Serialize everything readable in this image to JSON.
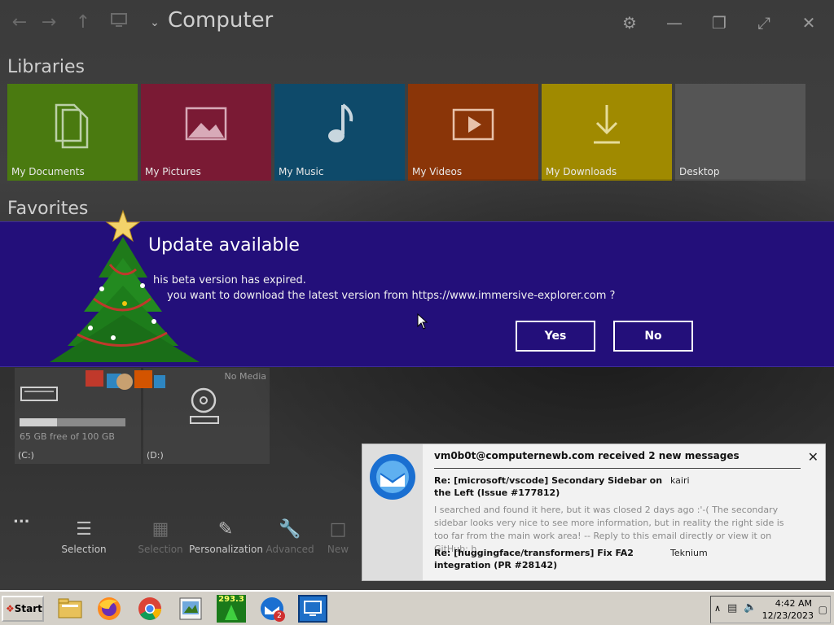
{
  "app": {
    "title": "Computer",
    "libraries_title": "Libraries",
    "favorites_title": "Favorites",
    "libraries": [
      {
        "label": "My Documents",
        "color": "#4a7a10",
        "icon": "documents-icon"
      },
      {
        "label": "My Pictures",
        "color": "#7a1a34",
        "icon": "pictures-icon"
      },
      {
        "label": "My Music",
        "color": "#0e4a6a",
        "icon": "music-icon"
      },
      {
        "label": "My Videos",
        "color": "#8a3508",
        "icon": "videos-icon"
      },
      {
        "label": "My Downloads",
        "color": "#a08a00",
        "icon": "downloads-icon"
      },
      {
        "label": "Desktop",
        "color": "#555555",
        "icon": "desktop-icon"
      }
    ],
    "drives": [
      {
        "label": "(C:)",
        "free": "65 GB free of 100 GB",
        "used_fraction": 0.35
      },
      {
        "label": "(D:)",
        "media": "No Media"
      }
    ],
    "more_label": "...",
    "commands": [
      {
        "label": "Selection",
        "enabled": true
      },
      {
        "label": "Selection",
        "enabled": false
      },
      {
        "label": "Personalization",
        "enabled": true
      },
      {
        "label": "Advanced",
        "enabled": false
      },
      {
        "label": "New",
        "enabled": false
      }
    ]
  },
  "dialog": {
    "title": "Update available",
    "line1": "his beta version has expired.",
    "line2": "you want to download the latest version from https://www.immersive-explorer.com ?",
    "yes": "Yes",
    "no": "No"
  },
  "tree_widget": {
    "icon": "christmas-tree-icon",
    "counter": "293.3"
  },
  "notification": {
    "header": "vm0b0t@computernewb.com received 2 new messages",
    "messages": [
      {
        "subject": "Re: [microsoft/vscode] Secondary Sidebar on the Left (Issue #177812)",
        "from": "kairi",
        "preview": "I searched and found it here, but it was closed 2 days ago :'-( The secondary sidebar looks very nice to see more information, but in reality the right side is too far from the main work area! -- Reply to this email directly or view it on GitHub: h"
      },
      {
        "subject": "Re: [huggingface/transformers] Fix FA2 integration (PR #28142)",
        "from": "Teknium"
      }
    ]
  },
  "taskbar": {
    "start_label": "Start",
    "badge_count": "2",
    "time": "4:42 AM",
    "date": "12/23/2023"
  }
}
